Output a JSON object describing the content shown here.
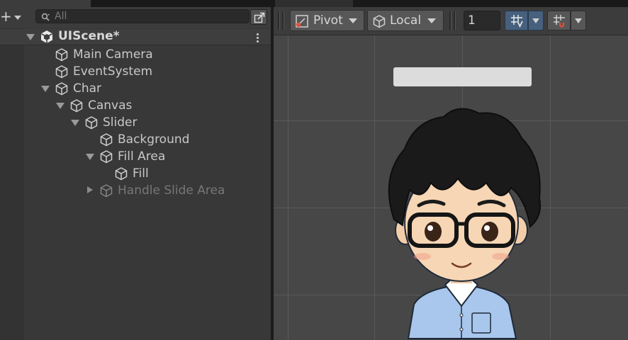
{
  "hierarchy": {
    "search_placeholder": "All",
    "scene_name": "UIScene*",
    "items": [
      {
        "label": "Main Camera"
      },
      {
        "label": "EventSystem"
      },
      {
        "label": "Char"
      },
      {
        "label": "Canvas"
      },
      {
        "label": "Slider"
      },
      {
        "label": "Background"
      },
      {
        "label": "Fill Area"
      },
      {
        "label": "Fill"
      },
      {
        "label": "Handle Slide Area"
      }
    ]
  },
  "scene_toolbar": {
    "pivot_label": "Pivot",
    "space_label": "Local",
    "snap_increment": "1"
  },
  "icons": {
    "add": "plus-icon",
    "search": "search-icon",
    "scene": "unity-logo-icon",
    "gameobject": "cube-icon",
    "pivot": "pivot-icon",
    "local": "local-space-icon",
    "snap": "grid-snap-icon",
    "grid": "grid-visibility-icon"
  },
  "colors": {
    "accent_active": "#46607e",
    "panel_bg": "#383838",
    "scene_bg": "#474747",
    "pivot_red": "#e0523a"
  }
}
